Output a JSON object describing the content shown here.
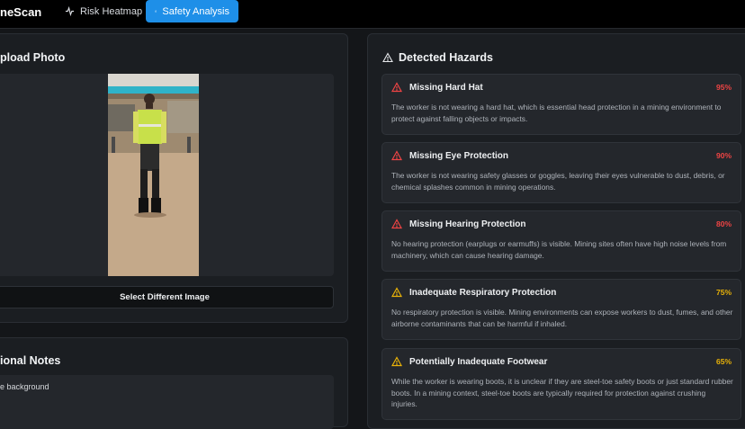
{
  "header": {
    "brand": "neScan",
    "nav": [
      {
        "label": "Risk Heatmap",
        "icon": "activity-icon"
      },
      {
        "label": "Safety Analysis",
        "icon": "camera-icon",
        "active": true
      }
    ]
  },
  "upload": {
    "title": "pload Photo",
    "select_button": "Select Different Image"
  },
  "notes": {
    "title": "ional Notes",
    "text": "e background"
  },
  "hazards": {
    "title": "Detected Hazards",
    "items": [
      {
        "title": "Missing Hard Hat",
        "confidence": "95%",
        "severity": "high",
        "description": "The worker is not wearing a hard hat, which is essential head protection in a mining environment to protect against falling objects or impacts."
      },
      {
        "title": "Missing Eye Protection",
        "confidence": "90%",
        "severity": "high",
        "description": "The worker is not wearing safety glasses or goggles, leaving their eyes vulnerable to dust, debris, or chemical splashes common in mining operations."
      },
      {
        "title": "Missing Hearing Protection",
        "confidence": "80%",
        "severity": "high",
        "description": "No hearing protection (earplugs or earmuffs) is visible. Mining sites often have high noise levels from machinery, which can cause hearing damage."
      },
      {
        "title": "Inadequate Respiratory Protection",
        "confidence": "75%",
        "severity": "medium",
        "description": "No respiratory protection is visible. Mining environments can expose workers to dust, fumes, and other airborne contaminants that can be harmful if inhaled."
      },
      {
        "title": "Potentially Inadequate Footwear",
        "confidence": "65%",
        "severity": "medium",
        "description": "While the worker is wearing boots, it is unclear if they are steel-toe safety boots or just standard rubber boots. In a mining context, steel-toe boots are typically required for protection against crushing injuries."
      }
    ]
  },
  "colors": {
    "accent": "#1e8fe8",
    "high": "#ef4444",
    "medium": "#eab308"
  }
}
